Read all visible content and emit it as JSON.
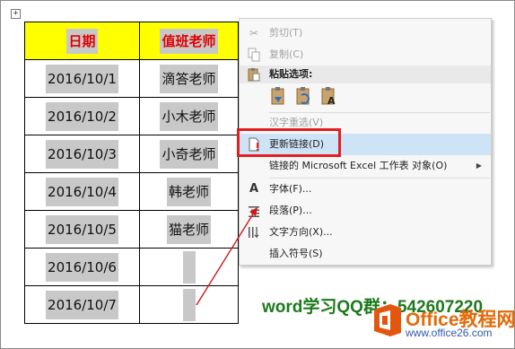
{
  "table": {
    "headers": [
      "日期",
      "值班老师"
    ],
    "rows": [
      [
        "2016/10/1",
        "滴答老师"
      ],
      [
        "2016/10/2",
        "小木老师"
      ],
      [
        "2016/10/3",
        "小奇老师"
      ],
      [
        "2016/10/4",
        "韩老师"
      ],
      [
        "2016/10/5",
        "猫老师"
      ],
      [
        "2016/10/6",
        ""
      ],
      [
        "2016/10/7",
        ""
      ]
    ]
  },
  "menu": {
    "cut": "剪切(T)",
    "copy": "复制(C)",
    "paste_options": "粘贴选项:",
    "hanzi_reselect": "汉字重选(V)",
    "update_link": "更新链接(D)",
    "linked_object": "链接的 Microsoft Excel 工作表 对象(O)",
    "font": "字体(F)...",
    "paragraph": "段落(P)...",
    "text_direction": "文字方向(X)...",
    "insert_symbol": "插入符号(S)"
  },
  "colors": {
    "header_bg": "#ffff00",
    "header_text": "#e00000",
    "highlight_outline": "#e21f1f",
    "menu_hover": "#cfe3f7"
  },
  "watermark": {
    "qq_group": "word学习QQ群：542607220",
    "brand": "Office教程网",
    "url": "www.office26.com"
  }
}
